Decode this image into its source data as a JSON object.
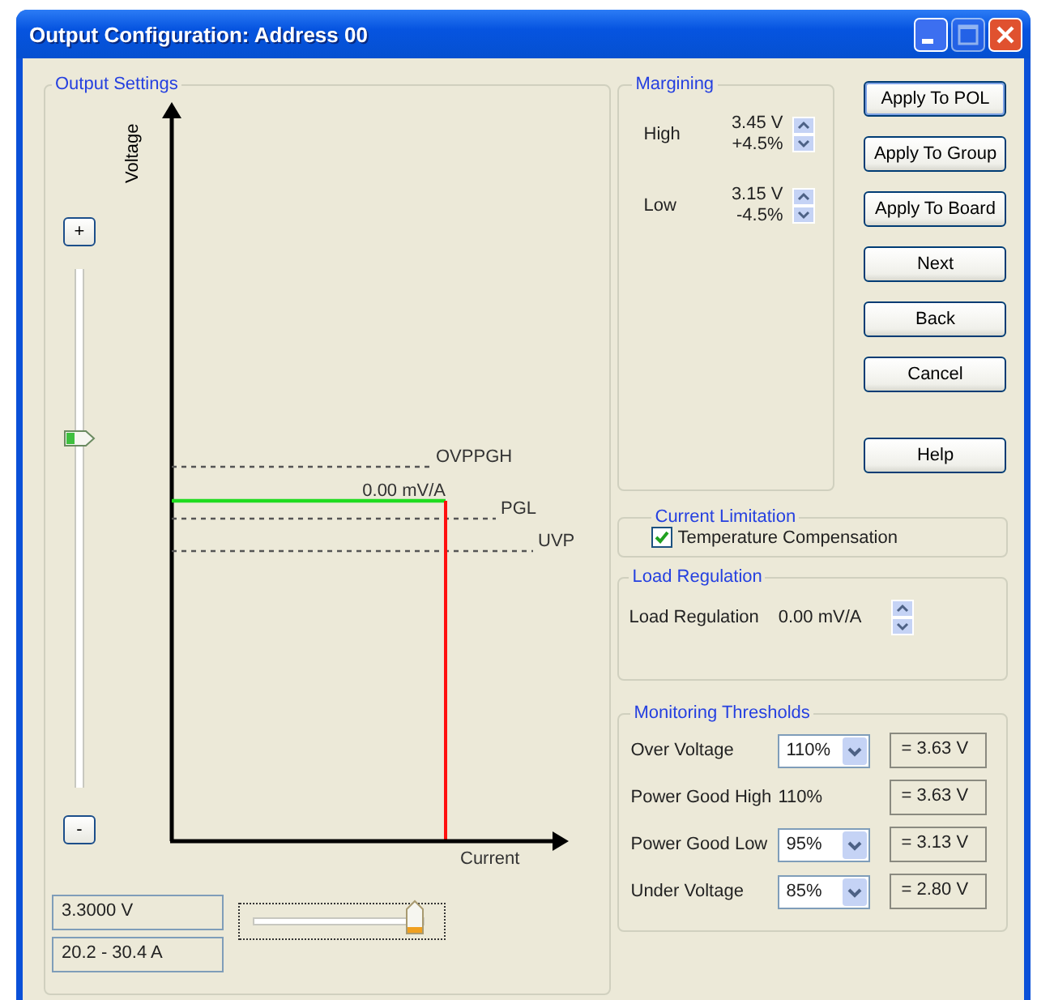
{
  "window": {
    "title": "Output Configuration: Address 00",
    "maximize_disabled": true
  },
  "output_settings": {
    "title": "Output Settings",
    "plus": "+",
    "minus": "-",
    "voltage_slider": {
      "level": 0.67
    },
    "chart": {
      "y_label": "Voltage",
      "x_label": "Current",
      "regulation_label": "0.00 mV/A",
      "thresholds": [
        {
          "label": "OVPPGH"
        },
        {
          "label": "PGL"
        },
        {
          "label": "UVP"
        }
      ]
    },
    "voltage_field": "3.3000 V",
    "current_field": "20.2 - 30.4 A",
    "current_slider": {
      "level": 0.95
    }
  },
  "margining": {
    "title": "Margining",
    "rows": [
      {
        "label": "High",
        "value": "3.45 V",
        "percent": "+4.5%"
      },
      {
        "label": "Low",
        "value": "3.15 V",
        "percent": "-4.5%"
      }
    ]
  },
  "buttons": [
    {
      "label": "Apply To POL",
      "default": true
    },
    {
      "label": "Apply To Group",
      "default": false
    },
    {
      "label": "Apply To Board",
      "default": false
    },
    {
      "label": "Next",
      "default": false
    },
    {
      "label": "Back",
      "default": false
    },
    {
      "label": "Cancel",
      "default": false
    },
    {
      "label": "Help",
      "default": false
    }
  ],
  "current_limitation": {
    "title": "Current Limitation",
    "checkbox": {
      "label": "Temperature Compensation",
      "checked": true
    }
  },
  "load_regulation": {
    "title": "Load Regulation",
    "label": "Load Regulation",
    "value": "0.00 mV/A"
  },
  "monitoring": {
    "title": "Monitoring Thresholds",
    "rows": [
      {
        "label": "Over Voltage",
        "kind": "dropdown",
        "value": "110%",
        "result": "= 3.63 V"
      },
      {
        "label": "Power Good High",
        "kind": "text",
        "value": "110%",
        "result": "= 3.63 V"
      },
      {
        "label": "Power Good Low",
        "kind": "dropdown",
        "value": "95%",
        "result": "= 3.13 V"
      },
      {
        "label": "Under Voltage",
        "kind": "dropdown",
        "value": "85%",
        "result": "= 2.80 V"
      }
    ]
  }
}
